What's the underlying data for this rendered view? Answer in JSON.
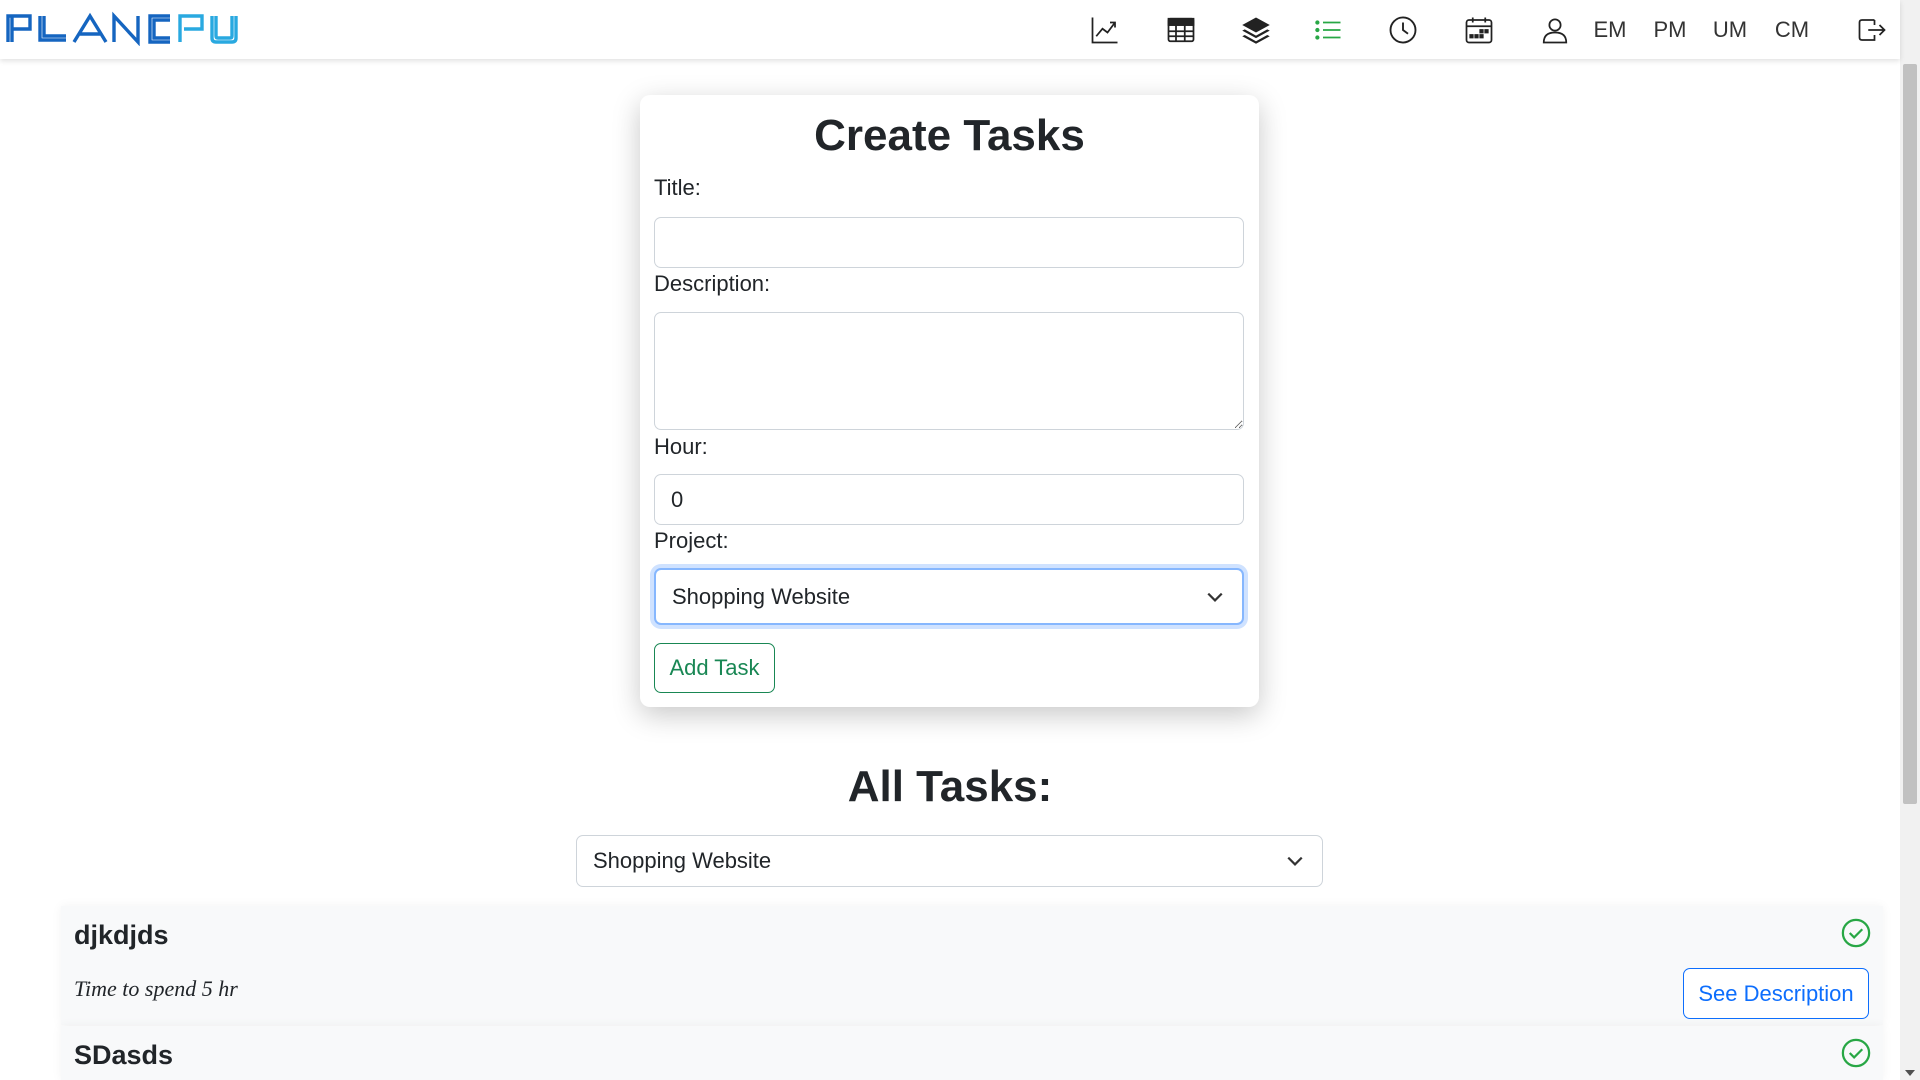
{
  "app": {
    "logo_text": "PLANCPU",
    "brand_color": "#1565c0"
  },
  "nav": {
    "icons": [
      "chart-line-icon",
      "table-icon",
      "layers-icon",
      "list-icon",
      "clock-icon",
      "calendar-icon",
      "user-icon",
      "logout-icon"
    ],
    "active_icon": "list-icon",
    "active_color": "#28a745",
    "text_items": [
      "EM",
      "PM",
      "UM",
      "CM"
    ]
  },
  "create_form": {
    "title": "Create Tasks",
    "title_label": "Title:",
    "title_value": "",
    "description_label": "Description:",
    "description_value": "",
    "hour_label": "Hour:",
    "hour_value": "0",
    "project_label": "Project:",
    "project_selected": "Shopping Website",
    "add_button": "Add Task"
  },
  "all_tasks": {
    "heading": "All Tasks:",
    "filter_selected": "Shopping Website",
    "tasks": [
      {
        "name": "djkdjds",
        "time_text": "Time to spend 5 hr",
        "status": "completed",
        "button": "See Description"
      },
      {
        "name": "SDasds",
        "time_text": "",
        "status": "completed",
        "button": ""
      }
    ]
  },
  "colors": {
    "success": "#198754",
    "primary": "#0d6efd",
    "check": "#28a745"
  }
}
